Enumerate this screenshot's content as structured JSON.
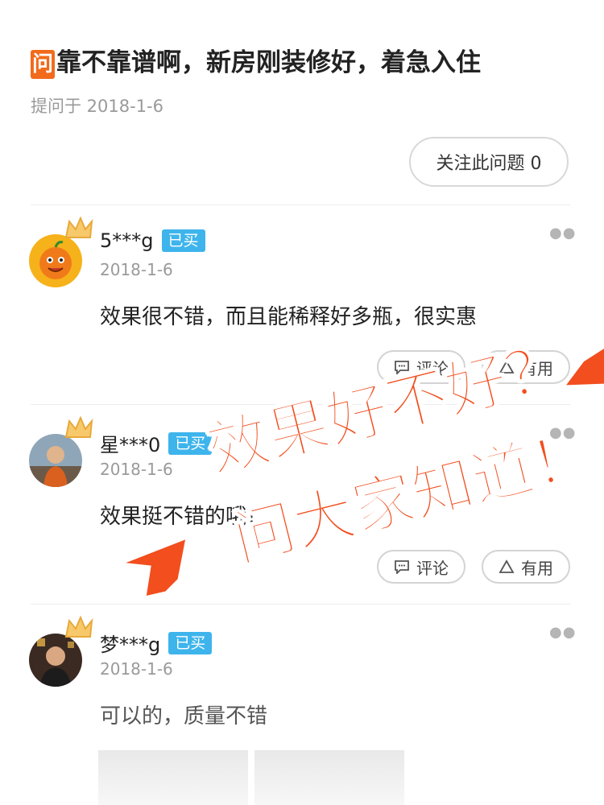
{
  "question": {
    "badge": "问",
    "title": "靠不靠谱啊，新房刚装修好，着急入住",
    "date": "提问于 2018-1-6",
    "follow_button": "关注此问题 0"
  },
  "answers": [
    {
      "user": "5***g",
      "badge": "已买",
      "date": "2018-1-6",
      "content": "效果很不错，而且能稀释好多瓶，很实惠",
      "comment_label": "评论",
      "useful_label": "有用"
    },
    {
      "user": "星***0",
      "badge": "已买",
      "date": "2018-1-6",
      "content": "效果挺不错的哦！",
      "comment_label": "评论",
      "useful_label": "有用"
    },
    {
      "user": "梦***g",
      "badge": "已买",
      "date": "2018-1-6",
      "content": "可以的，质量不错"
    }
  ],
  "overlay": {
    "line1": "效果好不好？",
    "line2": "问大家知道！"
  },
  "colors": {
    "accent_orange": "#f26a1b",
    "overlay_red": "#f24e1e",
    "bought_blue": "#3eb4ec"
  }
}
